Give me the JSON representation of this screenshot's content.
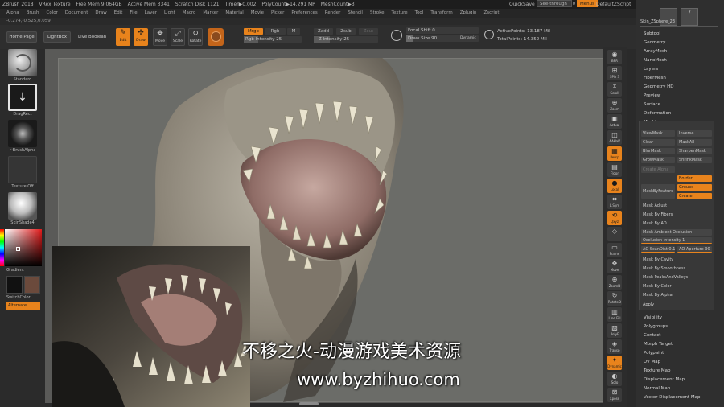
{
  "titlebar": {
    "items": [
      "ZBrush 2018",
      "VRex Texture",
      "Free Mem 9.064GB",
      "Active Mem 3341",
      "Scratch Disk 1121",
      "Timer▶0.002",
      "PolyCount▶14.291 MP",
      "MeshCount▶3"
    ],
    "quicksave": "QuickSave",
    "see_through": "See-through",
    "see_through_value": "0",
    "menus": "Menus",
    "default_zscript": "DefaultZScript"
  },
  "menubar": {
    "items": [
      "Alpha",
      "Brush",
      "Color",
      "Document",
      "Draw",
      "Edit",
      "File",
      "Layer",
      "Light",
      "Macro",
      "Marker",
      "Material",
      "Movie",
      "Picker",
      "Preferences",
      "Render",
      "Stencil",
      "Stroke",
      "Texture",
      "Tool",
      "Transform",
      "Zplugin",
      "Zscript"
    ]
  },
  "coords": "-0.274,-0.525,0.059",
  "toolshelf": {
    "home_page": "Home Page",
    "lightbox": "LightBox",
    "live_boolean": "Live Boolean",
    "tools": [
      {
        "label": "Edit",
        "icon": "edit-icon"
      },
      {
        "label": "Draw",
        "icon": "draw-icon"
      },
      {
        "label": "Move",
        "icon": "move-icon"
      },
      {
        "label": "Scale",
        "icon": "scale-icon"
      },
      {
        "label": "Rotate",
        "icon": "rotate-icon"
      }
    ],
    "mrgb": "Mrgb",
    "rgb": "Rgb",
    "m": "M",
    "zadd": "Zadd",
    "zsub": "Zsub",
    "zcut": "Zcut",
    "rgb_intensity_label": "Rgb Intensity",
    "rgb_intensity": "25",
    "z_intensity_label": "Z Intensity",
    "z_intensity": "25",
    "focal_shift_label": "Focal Shift",
    "focal_shift": "0",
    "draw_size_label": "Draw Size",
    "draw_size": "90",
    "dynamic": "Dynamic",
    "active_points_label": "ActivePoints:",
    "active_points": "13.187 Mil",
    "total_points_label": "TotalPoints:",
    "total_points": "14.352 Mil"
  },
  "leftshelf": {
    "standard": "Standard",
    "dragrect": "DragRect",
    "brush_alpha": "~BrushAlpha",
    "texture_off": "Texture Off",
    "skinshade": "SkinShade4",
    "gradient": "Gradient",
    "switchcolor": "SwitchColor",
    "alternate": "Alternate"
  },
  "rightstrip": {
    "items": [
      {
        "label": "BPR",
        "icon": "bpr-icon",
        "active": false
      },
      {
        "label": "SPix 3",
        "icon": "spix-icon",
        "active": false
      },
      {
        "label": "Scroll",
        "icon": "scroll-icon",
        "active": false
      },
      {
        "label": "Zoom",
        "icon": "zoom-icon",
        "active": false
      },
      {
        "label": "Actual",
        "icon": "actual-icon",
        "active": false
      },
      {
        "label": "AAHalf",
        "icon": "aahalf-icon",
        "active": false
      },
      {
        "label": "Persp",
        "icon": "persp-icon",
        "active": true
      },
      {
        "label": "Floor",
        "icon": "floor-icon",
        "active": false
      },
      {
        "label": "Local",
        "icon": "local-icon",
        "active": true
      },
      {
        "label": "L.Sym",
        "icon": "lsym-icon",
        "active": false
      },
      {
        "label": "Qxyz",
        "icon": "qxyz-icon",
        "active": true
      },
      {
        "label": "",
        "icon": "axis-icon",
        "active": false
      },
      {
        "label": "Frame",
        "icon": "frame-icon",
        "active": false
      },
      {
        "label": "Move",
        "icon": "move-view-icon",
        "active": false
      },
      {
        "label": "ZoomD",
        "icon": "zoomd-icon",
        "active": false
      },
      {
        "label": "RotateD",
        "icon": "rotated-icon",
        "active": false
      },
      {
        "label": "Line Fill",
        "icon": "linefill-icon",
        "active": false
      },
      {
        "label": "PolyF",
        "icon": "polyf-icon",
        "active": false
      },
      {
        "label": "Transp",
        "icon": "transp-icon",
        "active": false
      },
      {
        "label": "Dynamic",
        "icon": "dynamic-icon",
        "active": true
      },
      {
        "label": "Solo",
        "icon": "solo-icon",
        "active": false
      },
      {
        "label": "Xpose",
        "icon": "xpose-icon",
        "active": false
      }
    ]
  },
  "palette": {
    "subtool_thumb_num": "7",
    "skin_label": "Skin_ZSphere_23",
    "top_items": [
      "Subtool",
      "Geometry",
      "ArrayMesh",
      "NanoMesh",
      "Layers",
      "FiberMesh",
      "Geometry HD",
      "Preview",
      "Surface",
      "Deformation",
      "Masking"
    ],
    "masking": {
      "view_mask": "ViewMask",
      "inverse": "Inverse",
      "clear": "Clear",
      "mask_all": "MaskAll",
      "blur_mask": "BlurMask",
      "sharpen_mask": "SharpenMask",
      "grow_mask": "GrowMask",
      "shrink_mask": "ShrinkMask",
      "create_alpha": "Create Alpha",
      "mask_by_feature": "MaskByFeature",
      "border": "Border",
      "groups": "Groups",
      "create": "Create",
      "mask_adjust": "Mask Adjust",
      "mask_by_fibers": "Mask By Fibers",
      "mask_by_ao": "Mask By AO",
      "mask_ambient_occlusion": "Mask Ambient Occlusion",
      "occlusion_intensity_label": "Occlusion Intensity",
      "occlusion_intensity": "1",
      "ao_scandist_label": "AO ScanDist",
      "ao_scandist": "0.1",
      "ao_aperture_label": "AO Aperture",
      "ao_aperture": "90",
      "mask_by_cavity": "Mask By Cavity",
      "mask_by_smoothness": "Mask By Smoothness",
      "mask_peaks_valleys": "Mask PeaksAndValleys",
      "mask_by_color": "Mask By Color",
      "mask_by_alpha": "Mask By Alpha",
      "apply": "Apply"
    },
    "bottom_items": [
      "Visibility",
      "Polygroups",
      "Contact",
      "Morph Target",
      "Polypaint",
      "UV Map",
      "Texture Map",
      "Displacement Map",
      "Normal Map",
      "Vector Displacement Map"
    ]
  },
  "watermark": {
    "line1": "不移之火-动漫游戏美术资源",
    "line2": "www.byzhihuo.com"
  },
  "colors": {
    "accent": "#e8831c",
    "main_color": "#111111",
    "secondary_color": "#6b4a3c"
  }
}
